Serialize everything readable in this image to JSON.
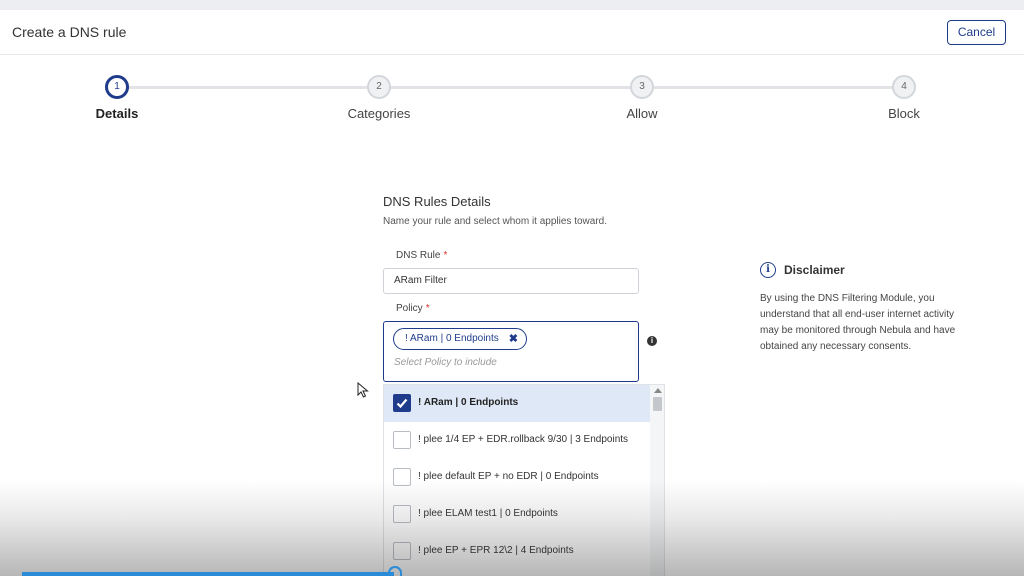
{
  "header": {
    "title": "Create a DNS rule",
    "cancel_label": "Cancel"
  },
  "stepper": {
    "steps": [
      {
        "number": "1",
        "label": "Details",
        "active": true
      },
      {
        "number": "2",
        "label": "Categories",
        "active": false
      },
      {
        "number": "3",
        "label": "Allow",
        "active": false
      },
      {
        "number": "4",
        "label": "Block",
        "active": false
      }
    ]
  },
  "form": {
    "title": "DNS Rules Details",
    "subtitle": "Name your rule and select whom it applies toward.",
    "dns_rule_label": "DNS Rule",
    "dns_rule_value": "ARam Filter",
    "required_mark": "*",
    "policy_label": "Policy",
    "selected_chip": "! ARam | 0 Endpoints",
    "chip_remove": "✖",
    "policy_placeholder": "Select Policy to include",
    "info_glyph": "i"
  },
  "dropdown": {
    "options": [
      {
        "label": "! ARam | 0 Endpoints",
        "checked": true
      },
      {
        "label": "! plee 1/4 EP + EDR.rollback 9/30 | 3 Endpoints",
        "checked": false
      },
      {
        "label": "! plee default EP + no EDR | 0 Endpoints",
        "checked": false
      },
      {
        "label": "! plee ELAM test1 | 0 Endpoints",
        "checked": false
      },
      {
        "label": "! plee EP + EPR 12\\2 | 4 Endpoints",
        "checked": false
      }
    ]
  },
  "disclaimer": {
    "icon_glyph": "i",
    "title": "Disclaimer",
    "text": "By using the DNS Filtering Module, you understand that all end-user internet activity may be monitored through Nebula and have obtained any necessary consents."
  },
  "video": {
    "progress_fraction": 0.38
  }
}
